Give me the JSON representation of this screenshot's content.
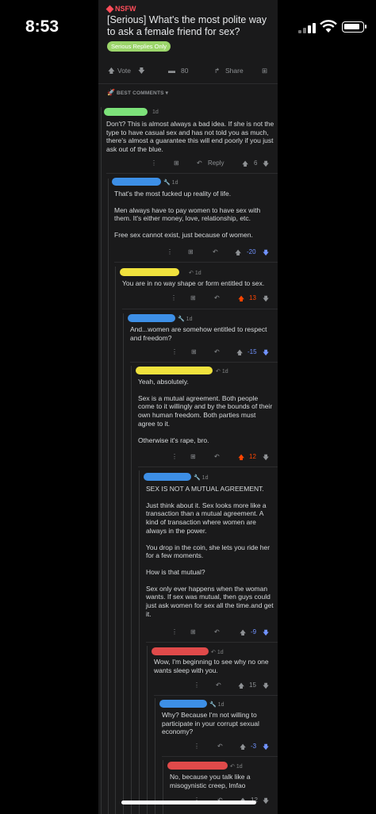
{
  "status_bar": {
    "time": "8:53"
  },
  "post": {
    "nsfw_label": "NSFW",
    "title": "[Serious] What's the most polite way to ask a female friend for sex?",
    "flair": "Serious Replies Only",
    "vote_label": "Vote",
    "comment_count": "80",
    "share_label": "Share"
  },
  "sort": {
    "label": "BEST COMMENTS"
  },
  "comments": [
    {
      "time": "1d",
      "body": [
        "Don't? This is almost always a bad idea. If she is not the type to have casual sex and has not told you as much, there's almost a guarantee this will end poorly if you just ask out of the blue."
      ],
      "reply_label": "Reply",
      "score": "6",
      "scribble_color": "#7de27a"
    },
    {
      "time": "1d",
      "body": [
        "That's the most fucked up reality of life.",
        "Men always have to pay women to have sex with them. It's either money, love, relationship, etc.",
        "Free sex cannot exist, just because of women."
      ],
      "score": "-20",
      "scribble_color": "#3d8fe6"
    },
    {
      "time": "1d",
      "body": [
        "You are in no way shape or form entitled to sex."
      ],
      "score": "13",
      "scribble_color": "#f0e23d"
    },
    {
      "time": "1d",
      "body": [
        "And...women are somehow entitled to respect and freedom?"
      ],
      "score": "-15",
      "scribble_color": "#3d8fe6"
    },
    {
      "time": "1d",
      "body": [
        "Yeah, absolutely.",
        "Sex is a mutual agreement. Both people come to it willingly and by the bounds of their own human freedom. Both parties must agree to it.",
        "Otherwise it's rape, bro."
      ],
      "score": "12",
      "scribble_color": "#f0e23d"
    },
    {
      "time": "1d",
      "body": [
        "SEX IS NOT A MUTUAL AGREEMENT.",
        "Just think about it. Sex looks more like a transaction than a mutual agreement. A kind of transaction where women are always in the power.",
        "You drop in the coin, she lets you ride her for a few moments.",
        "How is that mutual?",
        "Sex only ever happens when the woman wants. If sex was mutual, then guys could just ask women for sex all the time.and get it."
      ],
      "score": "-9",
      "scribble_color": "#3d8fe6"
    },
    {
      "time": "1d",
      "body": [
        "Wow, I'm beginning to see why no one wants sleep with you."
      ],
      "score": "15",
      "scribble_color": "#e04a4a"
    },
    {
      "time": "1d",
      "body": [
        "Why? Because I'm not willing to participate in your corrupt sexual economy?"
      ],
      "score": "-3",
      "scribble_color": "#3d8fe6"
    },
    {
      "time": "1d",
      "body": [
        "No, because you talk like a misogynistic creep, lmfao"
      ],
      "score": "12",
      "scribble_color": "#e04a4a"
    }
  ]
}
